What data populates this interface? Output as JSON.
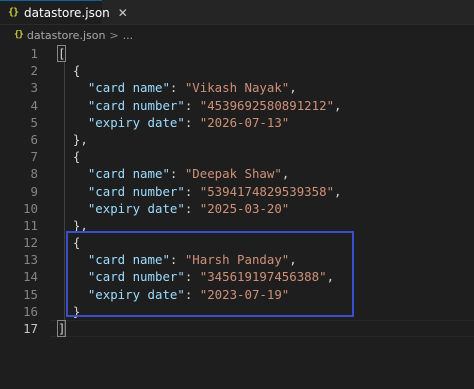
{
  "tab": {
    "icon": "{}",
    "title": "datastore.json",
    "close": "✕"
  },
  "breadcrumb": {
    "icon": "{}",
    "file": "datastore.json",
    "separator": ">",
    "more": "..."
  },
  "editor": {
    "line_numbers": [
      "1",
      "2",
      "3",
      "4",
      "5",
      "6",
      "7",
      "8",
      "9",
      "10",
      "11",
      "12",
      "13",
      "14",
      "15",
      "16",
      "17"
    ],
    "active_line": "17",
    "open_array": "[",
    "close_array": "]",
    "open_obj": "{",
    "close_obj": "},",
    "close_obj_last": "}",
    "colon": ": ",
    "comma": ",",
    "records": [
      {
        "card_name_key": "\"card name\"",
        "card_name_val": "\"Vikash Nayak\"",
        "card_number_key": "\"card number\"",
        "card_number_val": "\"4539692580891212\"",
        "expiry_key": "\"expiry date\"",
        "expiry_val": "\"2026-07-13\""
      },
      {
        "card_name_key": "\"card name\"",
        "card_name_val": "\"Deepak Shaw\"",
        "card_number_key": "\"card number\"",
        "card_number_val": "\"5394174829539358\"",
        "expiry_key": "\"expiry date\"",
        "expiry_val": "\"2025-03-20\""
      },
      {
        "card_name_key": "\"card name\"",
        "card_name_val": "\"Harsh Panday\"",
        "card_number_key": "\"card number\"",
        "card_number_val": "\"345619197456388\"",
        "expiry_key": "\"expiry date\"",
        "expiry_val": "\"2023-07-19\""
      }
    ]
  },
  "colors": {
    "background": "#1e1e1e",
    "key": "#9cdcfe",
    "string": "#ce9178",
    "annotation_box": "#3a4fd0"
  }
}
